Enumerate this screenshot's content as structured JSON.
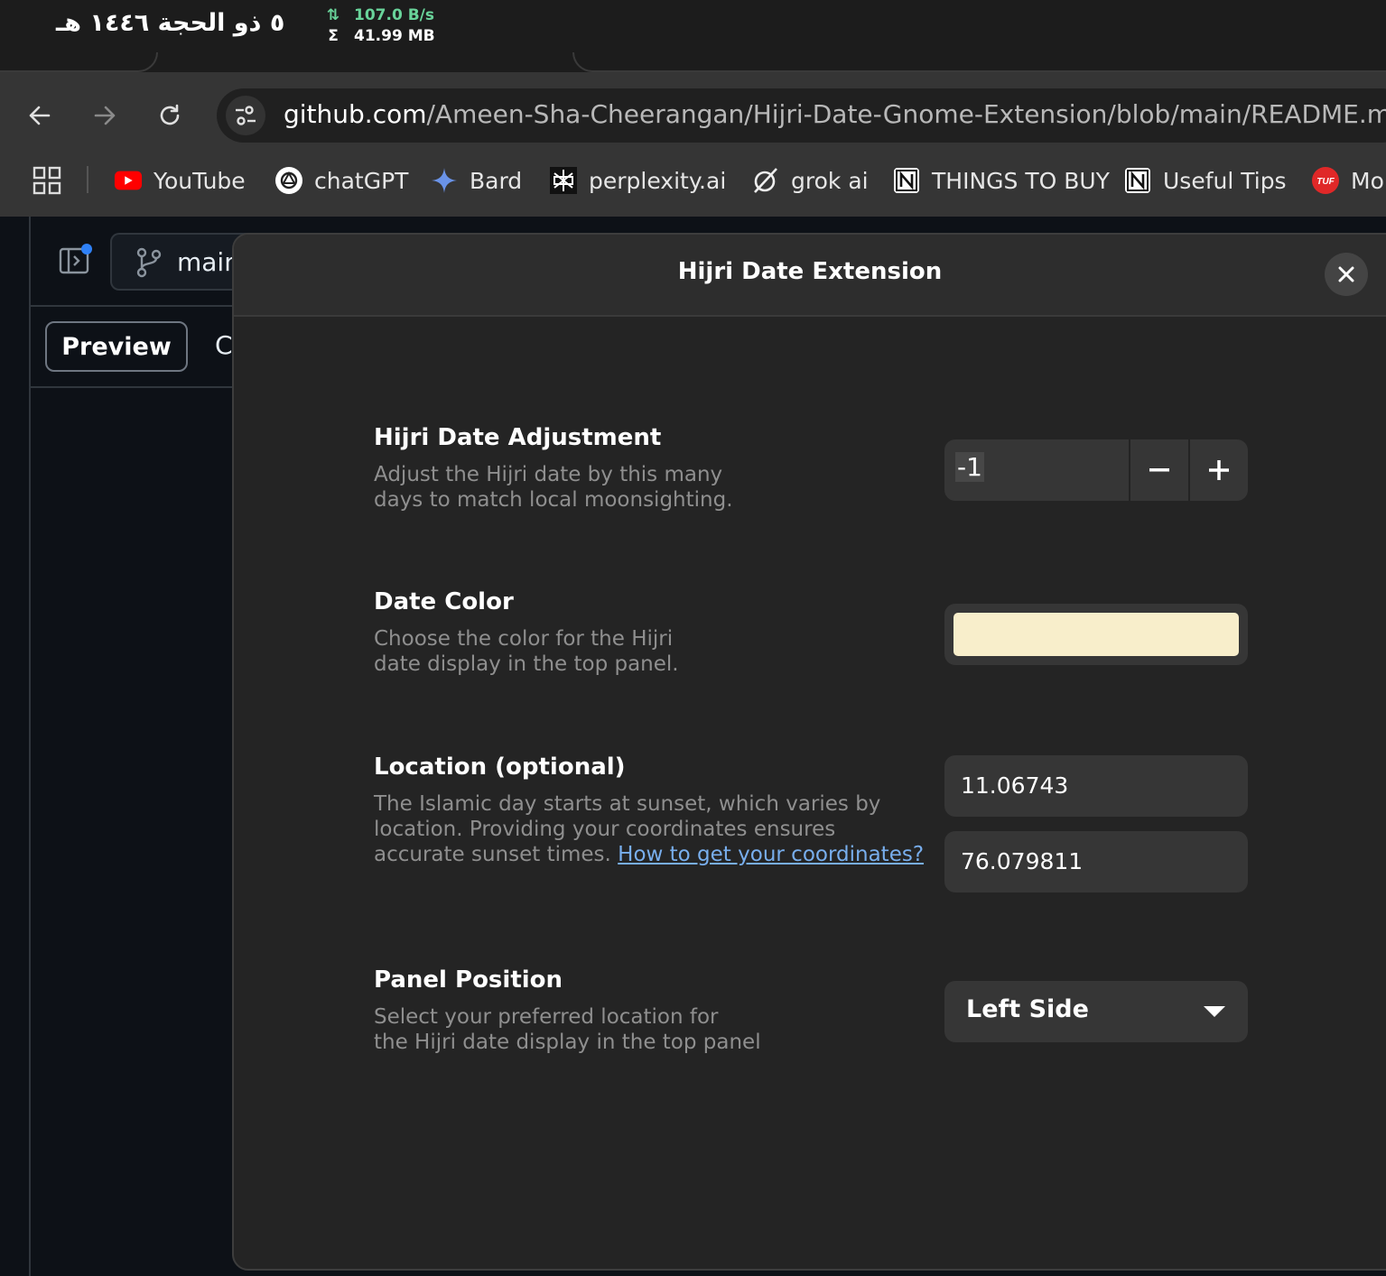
{
  "system_panel": {
    "hijri_date": "٥ ذو الحجة ١٤٤٦ هـ",
    "net_rate": "107.0 B/s",
    "net_total": "41.99 MB",
    "net_rate_symbol": "⇅",
    "net_total_symbol": "Σ"
  },
  "browser": {
    "url_host": "github.com",
    "url_path": "/Ameen-Sha-Cheerangan/Hijri-Date-Gnome-Extension/blob/main/README.md",
    "bookmarks": [
      {
        "label": "YouTube",
        "icon": "youtube-icon"
      },
      {
        "label": "chatGPT",
        "icon": "chatgpt-icon"
      },
      {
        "label": "Bard",
        "icon": "bard-icon"
      },
      {
        "label": "perplexity.ai",
        "icon": "perplexity-icon"
      },
      {
        "label": "grok ai",
        "icon": "grok-icon"
      },
      {
        "label": "THINGS TO BUY",
        "icon": "notion-icon"
      },
      {
        "label": "Useful Tips",
        "icon": "notion-icon"
      },
      {
        "label": "Mo",
        "icon": "tuf-icon"
      }
    ],
    "tuf_badge": "TUF"
  },
  "github": {
    "branch": "main",
    "tab_preview": "Preview",
    "tab_code": "C"
  },
  "dialog": {
    "title": "Hijri Date Extension",
    "adjustment": {
      "title": "Hijri Date Adjustment",
      "description": "Adjust the Hijri date by this many\ndays to match local moonsighting.",
      "value": "-1",
      "decrement": "−",
      "increment": "+"
    },
    "color": {
      "title": "Date Color",
      "description": "Choose the color for the Hijri\ndate display in the top panel.",
      "value": "#f8eecb"
    },
    "location": {
      "title": "Location (optional)",
      "description": "The Islamic day starts at sunset, which varies by\nlocation. Providing your coordinates ensures\naccurate sunset times. ",
      "link_text": "How to get your coordinates?",
      "latitude": "11.06743",
      "longitude": "76.079811"
    },
    "position": {
      "title": "Panel Position",
      "description": "Select your preferred location for\nthe Hijri date display in the top panel",
      "selected": "Left Side"
    }
  },
  "colors": {
    "accent_link": "#78aeed",
    "net_green": "#69d39a",
    "dialog_bg": "#242424"
  }
}
